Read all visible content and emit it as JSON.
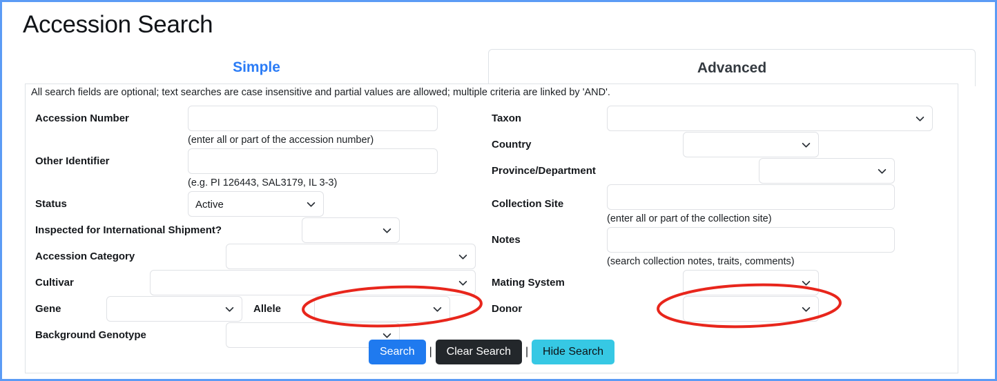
{
  "page": {
    "title": "Accession Search",
    "accent_blue": "#2b7cf6",
    "border_blue": "#5b9bf5",
    "annotation_color": "#e8261c"
  },
  "tabs": [
    {
      "id": "simple",
      "label": "Simple",
      "active": true
    },
    {
      "id": "advanced",
      "label": "Advanced",
      "active": false
    }
  ],
  "form": {
    "top_hint": "All search fields are optional; text searches are case insensitive and partial values are allowed; multiple criteria are linked by 'AND'.",
    "left_column": [
      {
        "id": "accession-number",
        "label": "Accession Number",
        "control": "text",
        "value": "",
        "placeholder": "",
        "helper": "(enter all or part of the accession number)"
      },
      {
        "id": "other-identifier",
        "label": "Other Identifier",
        "control": "text",
        "value": "",
        "placeholder": "",
        "helper": "(e.g. PI 126443, SAL3179, IL 3-3)"
      },
      {
        "id": "status",
        "label": "Status",
        "control": "select",
        "value": "Active",
        "helper": ""
      },
      {
        "id": "inspected-for-international-shipment",
        "label": "Inspected for International Shipment?",
        "control": "select",
        "value": "",
        "helper": ""
      },
      {
        "id": "accession-category",
        "label": "Accession Category",
        "control": "select",
        "value": "",
        "helper": ""
      },
      {
        "id": "cultivar",
        "label": "Cultivar",
        "control": "select",
        "value": "",
        "helper": ""
      },
      {
        "id": "gene",
        "label": "Gene",
        "control": "select",
        "value": "",
        "helper": ""
      },
      {
        "id": "allele",
        "label": "Allele",
        "control": "select",
        "value": "",
        "helper": "",
        "annotated": true
      },
      {
        "id": "background-genotype",
        "label": "Background Genotype",
        "control": "select",
        "value": "",
        "helper": ""
      }
    ],
    "right_column": [
      {
        "id": "taxon",
        "label": "Taxon",
        "control": "select",
        "value": "",
        "helper": ""
      },
      {
        "id": "country",
        "label": "Country",
        "control": "select",
        "value": "",
        "helper": ""
      },
      {
        "id": "province-department",
        "label": "Province/Department",
        "control": "select",
        "value": "",
        "helper": ""
      },
      {
        "id": "collection-site",
        "label": "Collection Site",
        "control": "text",
        "value": "",
        "placeholder": "",
        "helper": "(enter all or part of the collection site)"
      },
      {
        "id": "notes",
        "label": "Notes",
        "control": "text",
        "value": "",
        "placeholder": "",
        "helper": "(search collection notes, traits, comments)"
      },
      {
        "id": "mating-system",
        "label": "Mating System",
        "control": "select",
        "value": "",
        "helper": ""
      },
      {
        "id": "donor",
        "label": "Donor",
        "control": "select",
        "value": "",
        "helper": "",
        "annotated": true
      }
    ],
    "buttons": {
      "search": "Search",
      "clear": "Clear Search",
      "hide": "Hide Search",
      "separator": "|"
    }
  },
  "icons": {
    "chevron_down": "chevron-down-icon"
  }
}
